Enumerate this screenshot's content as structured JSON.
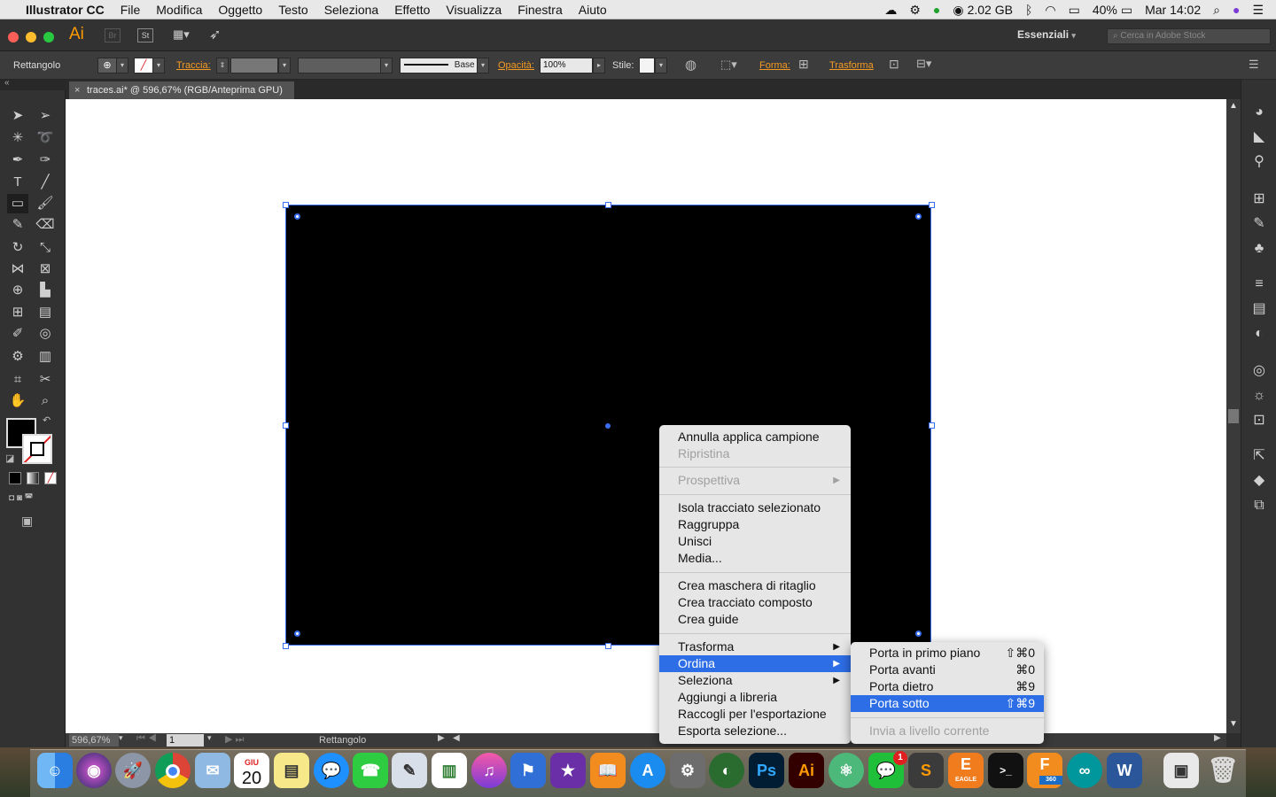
{
  "menubar": {
    "app_name": "Illustrator CC",
    "items": [
      "File",
      "Modifica",
      "Oggetto",
      "Testo",
      "Seleziona",
      "Effetto",
      "Visualizza",
      "Finestra",
      "Aiuto"
    ],
    "memory": "2.02 GB",
    "battery": "40%",
    "clock": "Mar 14:02"
  },
  "appbar": {
    "logo": "Ai",
    "br": "Br",
    "st": "St",
    "workspace": "Essenziali",
    "search_placeholder": "Cerca in Adobe Stock"
  },
  "control": {
    "object_type": "Rettangolo",
    "stroke_label": "Traccia:",
    "stroke_style": "Base",
    "opacity_label": "Opacità:",
    "opacity_value": "100%",
    "style_label": "Stile:",
    "shape_label": "Forma:",
    "transform_label": "Trasforma"
  },
  "document": {
    "tab_title": "traces.ai* @ 596,67% (RGB/Anteprima GPU)",
    "zoom": "596,67%",
    "artboard": "1",
    "status": "Rettangolo"
  },
  "context_menu": {
    "items": [
      {
        "label": "Annulla applica campione",
        "enabled": true
      },
      {
        "label": "Ripristina",
        "enabled": false
      },
      {
        "label": "Prospettiva",
        "enabled": false
      },
      {
        "label": "Isola tracciato selezionato",
        "enabled": true
      },
      {
        "label": "Raggruppa",
        "enabled": true
      },
      {
        "label": "Unisci",
        "enabled": true
      },
      {
        "label": "Media...",
        "enabled": true
      },
      {
        "label": "Crea maschera di ritaglio",
        "enabled": true
      },
      {
        "label": "Crea tracciato composto",
        "enabled": true
      },
      {
        "label": "Crea guide",
        "enabled": true
      },
      {
        "label": "Trasforma",
        "enabled": true
      },
      {
        "label": "Ordina",
        "enabled": true,
        "highlighted": true
      },
      {
        "label": "Seleziona",
        "enabled": true
      },
      {
        "label": "Aggiungi a libreria",
        "enabled": true
      },
      {
        "label": "Raccogli per l'esportazione",
        "enabled": true
      },
      {
        "label": "Esporta selezione...",
        "enabled": true
      }
    ]
  },
  "submenu": {
    "items": [
      {
        "label": "Porta in primo piano",
        "shortcut": "⇧⌘0"
      },
      {
        "label": "Porta avanti",
        "shortcut": "⌘0"
      },
      {
        "label": "Porta dietro",
        "shortcut": "⌘9"
      },
      {
        "label": "Porta sotto",
        "shortcut": "⇧⌘9",
        "highlighted": true
      },
      {
        "label": "Invia a livello corrente",
        "shortcut": "",
        "enabled": false
      }
    ]
  },
  "dock": {
    "calendar_month": "GIU",
    "calendar_day": "20",
    "messages_badge": "1",
    "ps": "Ps",
    "ai": "Ai",
    "eagle": "EAGLE",
    "fusion": "360"
  },
  "colors": {
    "accent": "#2d6ee6",
    "orange": "#f59a23",
    "selection": "#3a6df0"
  }
}
